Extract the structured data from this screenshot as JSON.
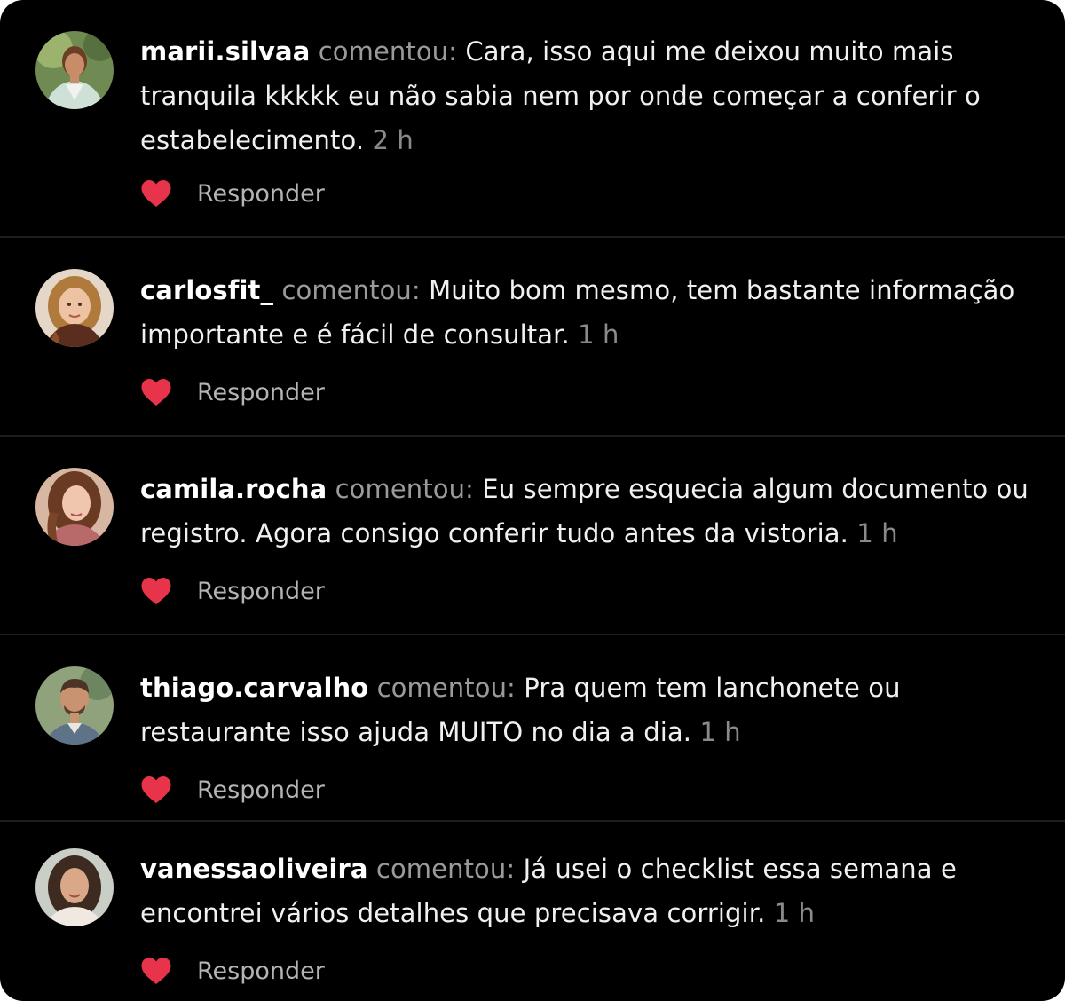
{
  "colors": {
    "background": "#000000",
    "divider": "#1e1e1e",
    "heart": "#e8344a",
    "username": "#ffffff",
    "secondary_text": "#9a9a9a"
  },
  "comments": [
    {
      "username": "marii.silvaa",
      "verb": "comentou:",
      "text": "Cara, isso aqui me deixou muito mais tranquila kkkkk eu não sabia nem por onde começar a conferir o estabelecimento.",
      "time": "2 h",
      "reply_label": "Responder",
      "like_icon": "heart-icon"
    },
    {
      "username": "carlosfit_",
      "verb": "comentou:",
      "text": "Muito bom mesmo, tem bastante informação importante e é fácil de consultar.",
      "time": "1 h",
      "reply_label": "Responder",
      "like_icon": "heart-icon"
    },
    {
      "username": "camila.rocha",
      "verb": "comentou:",
      "text": "Eu sempre esquecia algum documento ou registro. Agora consigo conferir tudo antes da vistoria.",
      "time": "1 h",
      "reply_label": "Responder",
      "like_icon": "heart-icon"
    },
    {
      "username": "thiago.carvalho",
      "verb": "comentou:",
      "text": "Pra quem tem lanchonete ou restaurante isso ajuda MUITO no dia a dia.",
      "time": "1 h",
      "reply_label": "Responder",
      "like_icon": "heart-icon"
    },
    {
      "username": "vanessaoliveira",
      "verb": "comentou:",
      "text": "Já usei o checklist essa semana e encontrei vários detalhes que precisava corrigir.",
      "time": "1 h",
      "reply_label": "Responder",
      "like_icon": "heart-icon"
    }
  ]
}
